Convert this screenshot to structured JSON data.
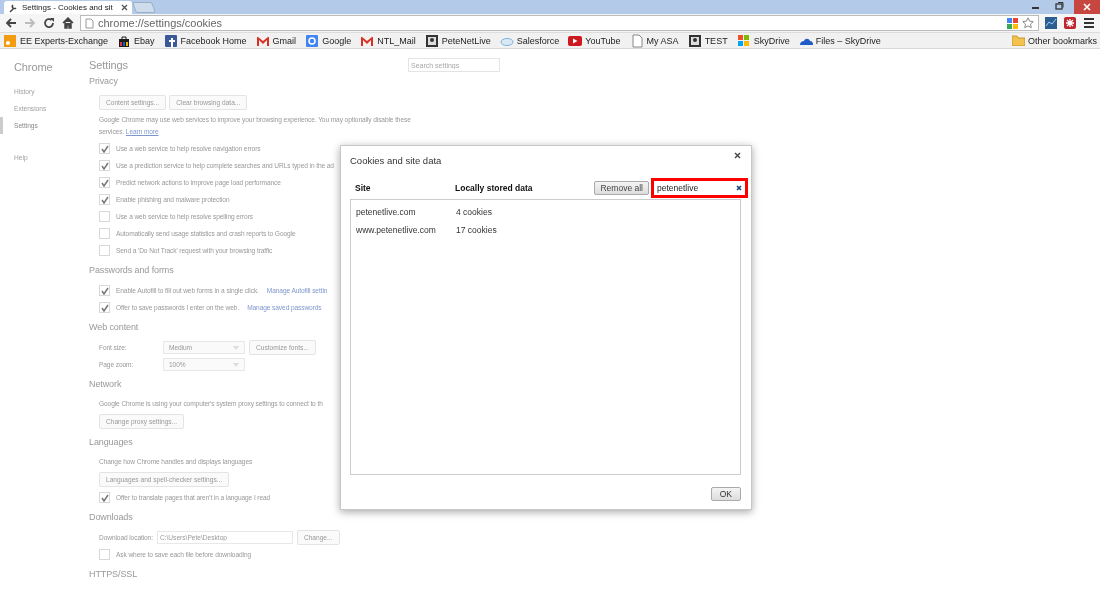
{
  "browser": {
    "tab_title": "Settings - Cookies and sit",
    "url": "chrome://settings/cookies",
    "bookmarks": [
      "EE Experts-Exchange",
      "Ebay",
      "Facebook Home",
      "Gmail",
      "Google",
      "NTL_Mail",
      "PeteNetLive",
      "Salesforce",
      "YouTube",
      "My ASA",
      "TEST",
      "SkyDrive",
      "Files – SkyDrive"
    ],
    "other_bookmarks": "Other bookmarks"
  },
  "settings_page": {
    "sidebar": {
      "title": "Chrome",
      "items": [
        {
          "label": "History",
          "selected": false
        },
        {
          "label": "Extensions",
          "selected": false
        },
        {
          "label": "Settings",
          "selected": true
        },
        {
          "label": "Help",
          "selected": false
        }
      ]
    },
    "title": "Settings",
    "search": {
      "placeholder": "Search settings"
    },
    "sections": [
      {
        "heading": "Privacy",
        "items": [
          {
            "kind": "buttons",
            "buttons": [
              "Content settings...",
              "Clear browsing data..."
            ]
          },
          {
            "kind": "text",
            "text": "Google Chrome may use web services to improve your browsing experience. You may optionally disable these services.",
            "link": "Learn more"
          },
          {
            "kind": "checkbox",
            "label": "Use a web service to help resolve navigation errors",
            "checked": true
          },
          {
            "kind": "checkbox",
            "label": "Use a prediction service to help complete searches and URLs typed in the ad",
            "checked": true
          },
          {
            "kind": "checkbox",
            "label": "Predict network actions to improve page load performance",
            "checked": true
          },
          {
            "kind": "checkbox",
            "label": "Enable phishing and malware protection",
            "checked": true
          },
          {
            "kind": "checkbox",
            "label": "Use a web service to help resolve spelling errors",
            "checked": false
          },
          {
            "kind": "checkbox",
            "label": "Automatically send usage statistics and crash reports to Google",
            "checked": false
          },
          {
            "kind": "checkbox",
            "label": "Send a 'Do Not Track' request with your browsing traffic",
            "checked": false
          }
        ]
      },
      {
        "heading": "Passwords and forms",
        "items": [
          {
            "kind": "checkbox",
            "label": "Enable Autofill to fill out web forms in a single click.",
            "link": "Manage Autofill settin",
            "checked": true
          },
          {
            "kind": "checkbox",
            "label": "Offer to save passwords I enter on the web.",
            "link": "Manage saved passwords",
            "checked": true
          }
        ]
      },
      {
        "heading": "Web content",
        "items": [
          {
            "kind": "select",
            "label": "Font size:",
            "value": "Medium",
            "button": "Customize fonts..."
          },
          {
            "kind": "select",
            "label": "Page zoom:",
            "value": "100%"
          }
        ]
      },
      {
        "heading": "Network",
        "items": [
          {
            "kind": "text",
            "text": "Google Chrome is using your computer's system proxy settings to connect to th"
          },
          {
            "kind": "buttons",
            "buttons": [
              "Change proxy settings..."
            ]
          }
        ]
      },
      {
        "heading": "Languages",
        "items": [
          {
            "kind": "text",
            "text": "Change how Chrome handles and displays languages"
          },
          {
            "kind": "buttons",
            "buttons": [
              "Languages and spell-checker settings..."
            ]
          },
          {
            "kind": "checkbox",
            "label": "Offer to translate pages that aren't in a language I read",
            "checked": true
          }
        ]
      },
      {
        "heading": "Downloads",
        "items": [
          {
            "kind": "path",
            "label": "Download location:",
            "value": "C:\\Users\\Pete\\Desktop",
            "button": "Change..."
          },
          {
            "kind": "checkbox",
            "label": "Ask where to save each file before downloading",
            "checked": false
          }
        ]
      },
      {
        "heading": "HTTPS/SSL"
      }
    ]
  },
  "dialog": {
    "title": "Cookies and site data",
    "columns": [
      "Site",
      "Locally stored data"
    ],
    "remove_all": "Remove all",
    "search": {
      "value": "petenetlive",
      "highlighted": true
    },
    "rows": [
      {
        "site": "petenetlive.com",
        "data": "4 cookies"
      },
      {
        "site": "www.petenetlive.com",
        "data": "17 cookies"
      }
    ],
    "ok": "OK"
  }
}
